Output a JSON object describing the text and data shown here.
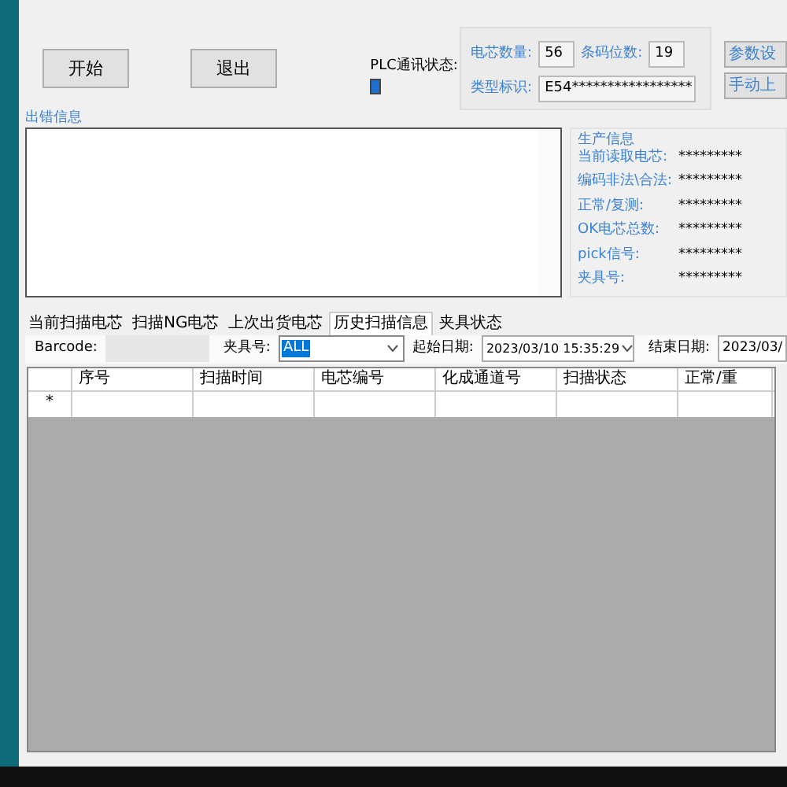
{
  "buttons": [
    {
      "label": "开始"
    },
    {
      "label": "退出"
    }
  ],
  "plc_status": {
    "label": "PLC通讯状态:",
    "on": true
  },
  "settings": {
    "fields": [
      {
        "label": "电芯数量:",
        "value": "56"
      },
      {
        "label": "条码位数:",
        "value": "19"
      },
      {
        "label": "类型标识:",
        "value": "E54*****************"
      }
    ],
    "buttons": [
      "参数设",
      "手动上"
    ]
  },
  "error_info": {
    "title": "出错信息"
  },
  "production_info": {
    "title": "生产信息",
    "rows": [
      {
        "label": "当前读取电芯:",
        "value": "*********"
      },
      {
        "label": "编码非法\\合法:",
        "value": "*********"
      },
      {
        "label": "正常/复测:",
        "value": "*********"
      },
      {
        "label": "OK电芯总数:",
        "value": "*********"
      },
      {
        "label": "pick信号:",
        "value": "*********"
      },
      {
        "label": "夹具号:",
        "value": "*********"
      }
    ]
  },
  "tabs": [
    {
      "label": "当前扫描电芯",
      "selected": false
    },
    {
      "label": "扫描NG电芯",
      "selected": false
    },
    {
      "label": "上次出货电芯",
      "selected": false
    },
    {
      "label": "历史扫描信息",
      "selected": true
    },
    {
      "label": "夹具状态",
      "selected": false
    }
  ],
  "filter": {
    "barcode_label": "Barcode:",
    "fixture_label": "夹具号:",
    "fixture_value": "ALL",
    "start_label": "起始日期:",
    "start_value": "2023/03/10 15:35:29",
    "end_label": "结束日期:",
    "end_value": "2023/03/"
  },
  "grid": {
    "columns": [
      "序号",
      "扫描时间",
      "电芯编号",
      "化成通道号",
      "扫描状态",
      "正常/重"
    ],
    "rows": [
      {
        "marker": "*"
      }
    ]
  }
}
